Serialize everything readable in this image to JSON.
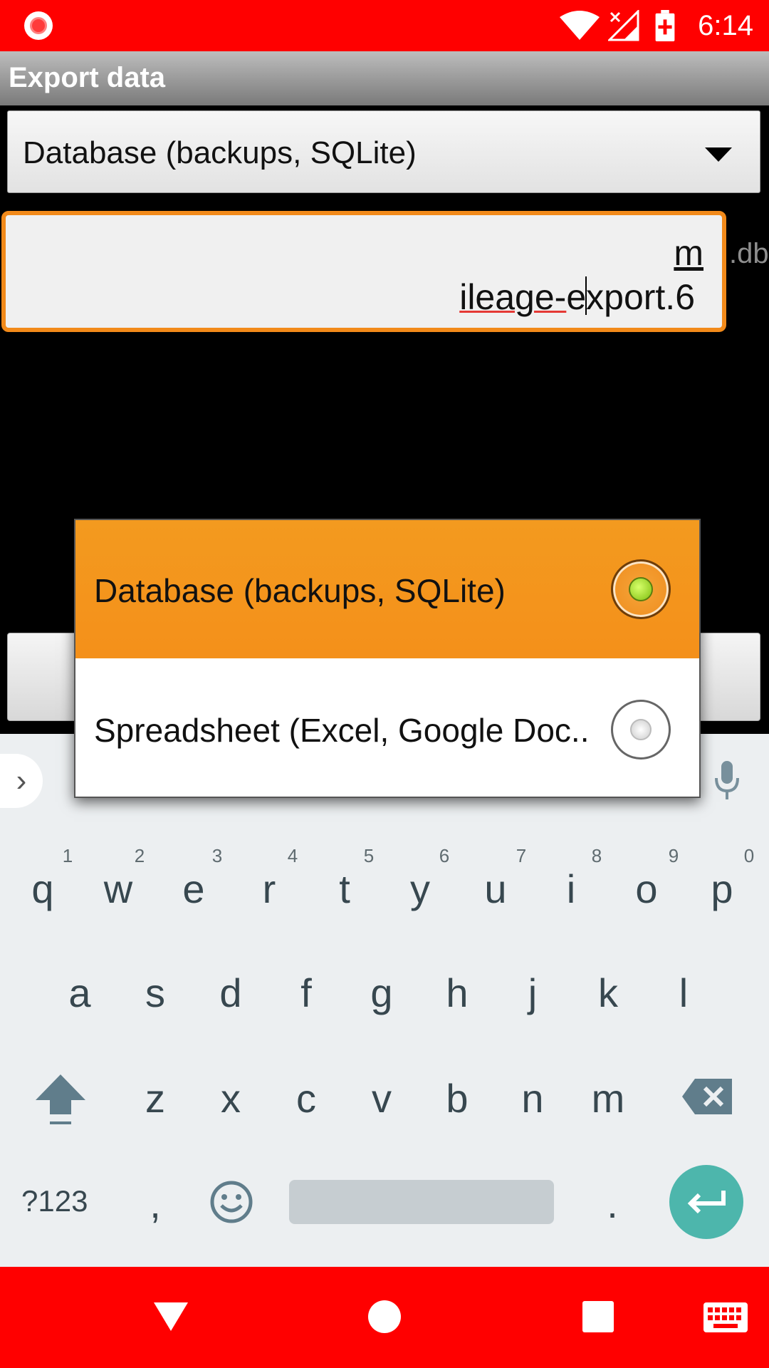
{
  "status_bar": {
    "time": "6:14"
  },
  "app_title": "Export data",
  "format_spinner": {
    "selected": "Database (backups, SQLite)"
  },
  "filename_input": {
    "line1": "m",
    "line2_before_err": "",
    "line2_err": "ileage-",
    "line2_after": "e",
    "line2_after_caret": "xport.6",
    "suffix": ".db"
  },
  "dialog": {
    "options": [
      {
        "label": "Database (backups, SQLite)",
        "selected": true
      },
      {
        "label": "Spreadsheet (Excel, Google Doc..",
        "selected": false
      }
    ]
  },
  "keyboard": {
    "row1": [
      "q",
      "w",
      "e",
      "r",
      "t",
      "y",
      "u",
      "i",
      "o",
      "p"
    ],
    "row1_hints": [
      "1",
      "2",
      "3",
      "4",
      "5",
      "6",
      "7",
      "8",
      "9",
      "0"
    ],
    "row2": [
      "a",
      "s",
      "d",
      "f",
      "g",
      "h",
      "j",
      "k",
      "l"
    ],
    "row3": [
      "z",
      "x",
      "c",
      "v",
      "b",
      "n",
      "m"
    ],
    "symbols_label": "?123",
    "comma": ",",
    "period": "."
  },
  "colors": {
    "status_bar": "#ff0000",
    "accent": "#f28a1a",
    "enter_key": "#4db6ac"
  },
  "icons": [
    "record-icon",
    "wifi-icon",
    "no-signal-icon",
    "battery-charging-icon",
    "dropdown-arrow-icon",
    "chevron-right-icon",
    "mic-icon",
    "shift-icon",
    "backspace-icon",
    "emoji-icon",
    "enter-icon",
    "back-nav-icon",
    "home-nav-icon",
    "recents-nav-icon",
    "keyboard-nav-icon"
  ]
}
